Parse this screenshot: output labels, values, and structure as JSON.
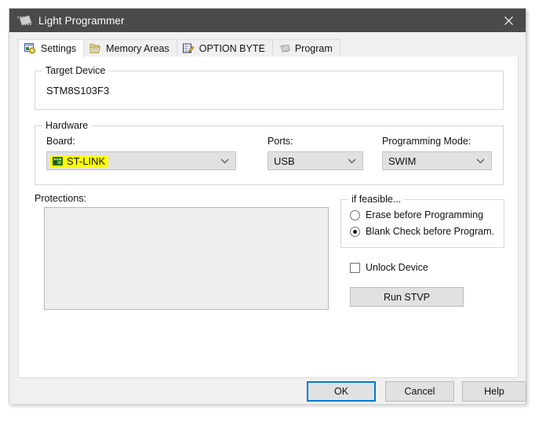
{
  "window": {
    "title": "Light Programmer",
    "icon": "chip-icon",
    "close_label": "✕"
  },
  "tabs": [
    {
      "label": "Settings",
      "icon": "settings-gear-icon",
      "active": true
    },
    {
      "label": "Memory Areas",
      "icon": "memory-areas-icon",
      "active": false
    },
    {
      "label": "OPTION BYTE",
      "icon": "option-byte-icon",
      "active": false
    },
    {
      "label": "Program",
      "icon": "program-chip-icon",
      "active": false
    }
  ],
  "target_device": {
    "group_title": "Target Device",
    "device": "STM8S103F3"
  },
  "hardware": {
    "group_title": "Hardware",
    "board": {
      "label": "Board:",
      "value": "ST-LINK",
      "icon": "board-chip-icon",
      "highlighted": true,
      "highlight_color": "#ffff00",
      "arrow": "⌄"
    },
    "ports": {
      "label": "Ports:",
      "value": "USB",
      "arrow": "⌄"
    },
    "programming_mode": {
      "label": "Programming Mode:",
      "value": "SWIM",
      "arrow": "⌄"
    }
  },
  "protections": {
    "label": "Protections:",
    "items": []
  },
  "if_feasible": {
    "group_title": "if feasible...",
    "options": [
      {
        "label": "Erase before Programming",
        "selected": false
      },
      {
        "label": "Blank Check before Program.",
        "selected": true
      }
    ]
  },
  "unlock_device": {
    "label": "Unlock Device",
    "checked": false
  },
  "run_stvp": {
    "label": "Run STVP"
  },
  "footer": {
    "ok": "OK",
    "cancel": "Cancel",
    "help": "Help",
    "default_button": "OK",
    "focus_color": "#0078d7"
  }
}
